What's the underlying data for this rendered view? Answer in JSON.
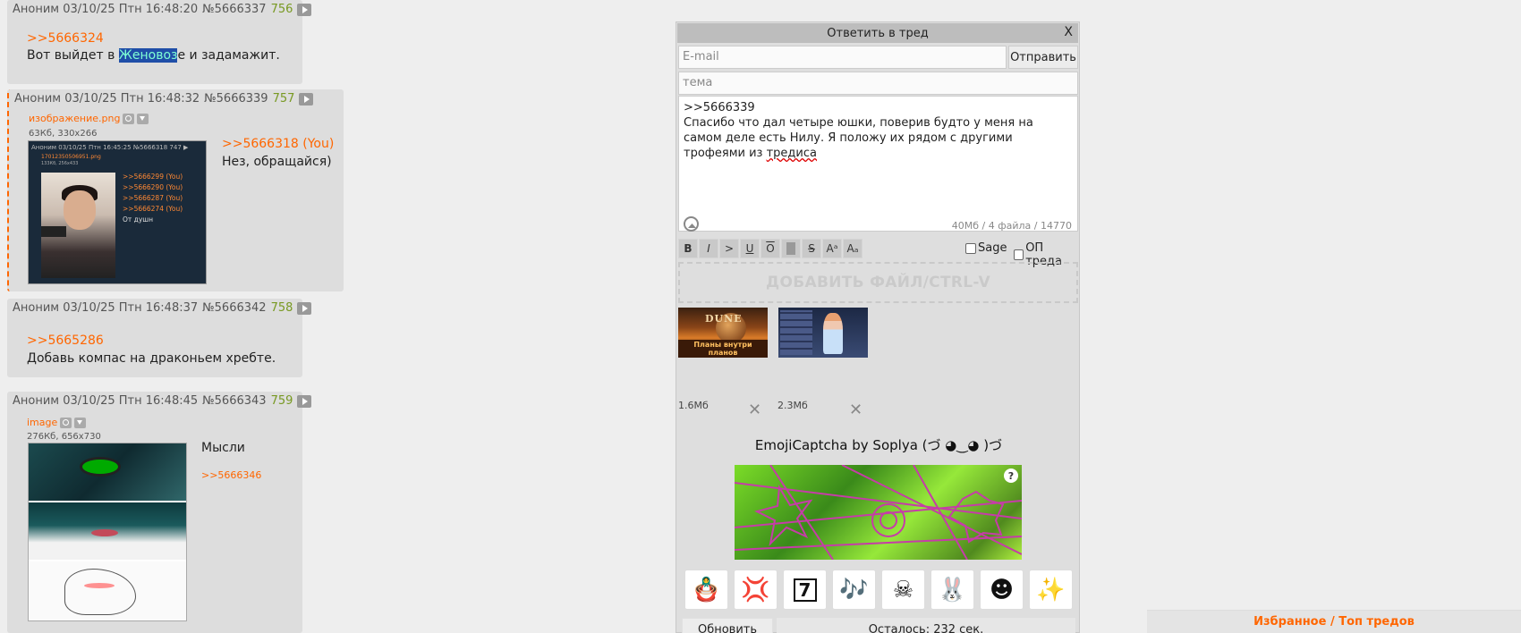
{
  "posts": [
    {
      "author": "Аноним",
      "date": "03/10/25 Птн 16:48:20",
      "num": "№5666337",
      "count": "756",
      "reply": ">>5666324",
      "text_before": "Вот выйдет в ",
      "text_hl": "Женовоз",
      "text_after": "е и задамажит."
    },
    {
      "author": "Аноним",
      "date": "03/10/25 Птн 16:48:32",
      "num": "№5666339",
      "count": "757",
      "file_name": "изображение.png",
      "file_meta": "63Кб, 330x266",
      "reply": ">>5666318 (You)",
      "text": "Нез, обращайся)",
      "thumb": {
        "header": "Аноним 03/10/25 Птн 16:45:25 №5666318 747 ▶",
        "file": "17012350506951.png",
        "meta": "133Кб, 256x433",
        "lines": [
          ">>5666299 (You)",
          ">>5666290 (You)",
          ">>5666287 (You)",
          ">>5666274 (You)"
        ],
        "text": "От душн"
      }
    },
    {
      "author": "Аноним",
      "date": "03/10/25 Птн 16:48:37",
      "num": "№5666342",
      "count": "758",
      "reply": ">>5665286",
      "text": "Добавь компас на драконьем хребте."
    },
    {
      "author": "Аноним",
      "date": "03/10/25 Птн 16:48:45",
      "num": "№5666343",
      "count": "759",
      "file_name": "image",
      "file_meta": "276Кб, 656x730",
      "text": "Мысли",
      "reply": ">>5666346"
    }
  ],
  "form": {
    "title": "Ответить в тред",
    "close": "X",
    "email_placeholder": "E-mail",
    "send_label": "Отправить",
    "subject_placeholder": "тема",
    "message_line1": ">>5666339",
    "message_line2": "Спасибо что дал четыре юшки, поверив будто у меня на самом деле есть Нилу. Я положу их рядом с другими трофеями из ",
    "message_misspelled": "тредиса",
    "counter": "40Мб / 4 файла / 14770",
    "toolbar": [
      "B",
      "I",
      ">",
      "U",
      "O",
      "",
      "S",
      "Aᵃ",
      "Aₐ"
    ],
    "sage_label": "Sage",
    "op_label": "ОП треда",
    "dropzone": "ДОБАВИТЬ ФАЙЛ/CTRL-V",
    "attachments": [
      {
        "size": "1.6Мб",
        "title": "DUNE",
        "caption": "Планы внутри планов"
      },
      {
        "size": "2.3Мб"
      }
    ],
    "remove_glyph": "✕",
    "captcha_title": "EmojiCaptcha by Soplya (づ ◕‿◕ )づ",
    "captcha_help": "?",
    "emojis": [
      "🪆",
      "💢",
      "7",
      "🎶",
      "☠",
      "🐰",
      "☻",
      "✨"
    ],
    "refresh_label": "Обновить",
    "timer": "Осталось: 232 сек."
  },
  "favorites": "Избранное / Топ тредов",
  "colors": {
    "accent": "#ff6600",
    "count": "#789922",
    "post_bg": "#dddddd",
    "page_bg": "#eeeeee"
  }
}
